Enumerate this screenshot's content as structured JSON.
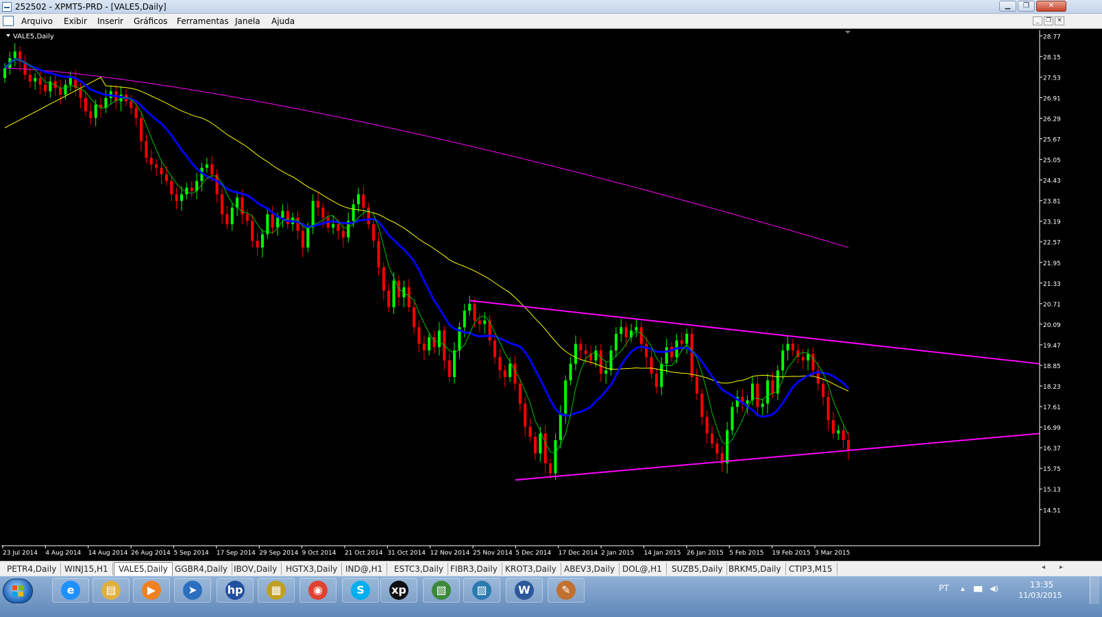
{
  "window": {
    "title": "252502 - XPMT5-PRD - [VALE5,Daily]",
    "min_label": "▁",
    "max_label": "❐",
    "close_label": "✕"
  },
  "menu": {
    "items": [
      "Arquivo",
      "Exibir",
      "Inserir",
      "Gráficos",
      "Ferramentas",
      "Janela",
      "Ajuda"
    ],
    "mdi_min": "_",
    "mdi_restore": "❐",
    "mdi_close": "✕"
  },
  "chart": {
    "symbol_label": "VALE5,Daily",
    "colors": {
      "background": "#000000",
      "bull": "#00ff00",
      "bear": "#ff0000",
      "fast_ma": "#00c000",
      "mid_ma": "#0000ff",
      "slow_ma": "#ffff00",
      "long_ma": "#ff00ff",
      "trend_lines": "#ff00ff",
      "axis_text": "#ffffff"
    }
  },
  "chart_data": {
    "type": "candlestick",
    "instrument": "VALE5",
    "timeframe": "Daily",
    "ylim": [
      14.0,
      28.9
    ],
    "y_ticks": [
      28.77,
      28.15,
      27.53,
      26.91,
      26.29,
      25.67,
      25.05,
      24.43,
      23.81,
      23.19,
      22.57,
      21.95,
      21.33,
      20.71,
      20.09,
      19.47,
      18.85,
      18.23,
      17.61,
      16.99,
      16.37,
      15.75,
      15.13,
      14.51
    ],
    "x_ticks": [
      "23 Jul 2014",
      "4 Aug 2014",
      "14 Aug 2014",
      "26 Aug 2014",
      "5 Sep 2014",
      "17 Sep 2014",
      "29 Sep 2014",
      "9 Oct 2014",
      "21 Oct 2014",
      "31 Oct 2014",
      "12 Nov 2014",
      "25 Nov 2014",
      "5 Dec 2014",
      "17 Dec 2014",
      "2 Jan 2015",
      "14 Jan 2015",
      "26 Jan 2015",
      "5 Feb 2015",
      "19 Feb 2015",
      "3 Mar 2015"
    ],
    "closes": [
      27.8,
      28.1,
      28.3,
      28.0,
      27.6,
      27.4,
      27.5,
      27.3,
      27.1,
      27.4,
      27.2,
      27.0,
      27.3,
      27.5,
      27.2,
      26.9,
      26.5,
      26.3,
      26.7,
      26.6,
      26.9,
      27.1,
      26.8,
      27.0,
      26.8,
      26.6,
      26.3,
      25.6,
      25.1,
      24.9,
      24.8,
      24.6,
      24.4,
      24.0,
      23.8,
      24.0,
      24.2,
      24.1,
      24.4,
      24.8,
      24.9,
      24.6,
      24.0,
      23.4,
      23.1,
      23.6,
      23.9,
      23.4,
      23.2,
      22.6,
      22.4,
      22.8,
      23.4,
      23.0,
      23.3,
      23.5,
      23.1,
      23.3,
      22.9,
      22.4,
      23.0,
      23.8,
      23.6,
      23.3,
      23.0,
      23.1,
      22.9,
      22.7,
      23.2,
      23.7,
      24.0,
      23.6,
      23.1,
      22.6,
      21.8,
      21.1,
      20.6,
      21.4,
      20.9,
      21.2,
      20.6,
      20.0,
      19.5,
      19.3,
      19.7,
      19.4,
      19.9,
      19.0,
      18.5,
      19.3,
      20.0,
      20.5,
      20.7,
      20.2,
      20.1,
      20.2,
      19.6,
      19.1,
      18.7,
      18.5,
      18.9,
      18.3,
      17.7,
      17.0,
      16.7,
      16.2,
      16.8,
      15.9,
      15.6,
      16.6,
      17.4,
      18.4,
      18.9,
      19.5,
      19.3,
      19.2,
      19.0,
      19.3,
      18.6,
      18.7,
      19.3,
      19.8,
      20.0,
      19.7,
      19.9,
      20.0,
      19.5,
      19.1,
      18.6,
      18.2,
      18.9,
      19.4,
      19.1,
      19.6,
      19.5,
      19.8,
      18.5,
      18.0,
      17.3,
      16.8,
      16.5,
      16.2,
      15.9,
      16.9,
      17.6,
      17.9,
      17.7,
      17.8,
      18.3,
      17.6,
      17.7,
      18.4,
      18.0,
      18.7,
      19.3,
      19.5,
      19.3,
      19.1,
      19.0,
      19.2,
      18.7,
      18.3,
      17.9,
      17.2,
      16.8,
      16.9,
      16.6,
      16.3
    ]
  },
  "tabs": [
    "PETR4,Daily",
    "WINJ15,H1",
    "VALE5,Daily",
    "GGBR4,Daily",
    "IBOV,Daily",
    "HGTX3,Daily",
    "IND@,H1",
    "ESTC3,Daily",
    "FIBR3,Daily",
    "KROT3,Daily",
    "ABEV3,Daily",
    "DOL@,H1",
    "SUZB5,Daily",
    "BRKM5,Daily",
    "CTIP3,M15"
  ],
  "active_tab": "VALE5,Daily",
  "tab_scroll": {
    "left": "◂",
    "right": "▸"
  },
  "taskbar": {
    "apps": [
      {
        "name": "internet-explorer-icon",
        "glyph": "e",
        "color": "#1e90ff"
      },
      {
        "name": "file-explorer-icon",
        "glyph": "▤",
        "color": "#e0b040"
      },
      {
        "name": "media-player-icon",
        "glyph": "▶",
        "color": "#f08020"
      },
      {
        "name": "network-icon",
        "glyph": "➤",
        "color": "#2a6fc0"
      },
      {
        "name": "hp-icon",
        "glyph": "hp",
        "color": "#2050a0"
      },
      {
        "name": "folder-tool-icon",
        "glyph": "▦",
        "color": "#c0a020"
      },
      {
        "name": "chrome-icon",
        "glyph": "◉",
        "color": "#e04030"
      },
      {
        "name": "skype-icon",
        "glyph": "S",
        "color": "#00aff0"
      },
      {
        "name": "xp-icon",
        "glyph": "xp",
        "color": "#101010"
      },
      {
        "name": "chart-app-icon",
        "glyph": "▧",
        "color": "#3a8a3a"
      },
      {
        "name": "photo-viewer-icon",
        "glyph": "▨",
        "color": "#2a7ab0"
      },
      {
        "name": "word-icon",
        "glyph": "W",
        "color": "#2b579a"
      },
      {
        "name": "paint-icon",
        "glyph": "✎",
        "color": "#c07030"
      }
    ],
    "tray": {
      "lang": "PT",
      "up_arrow": "▴",
      "signal": "▮▮▮",
      "volume": "◀)"
    },
    "clock": {
      "time": "13:35",
      "date": "11/03/2015"
    }
  }
}
